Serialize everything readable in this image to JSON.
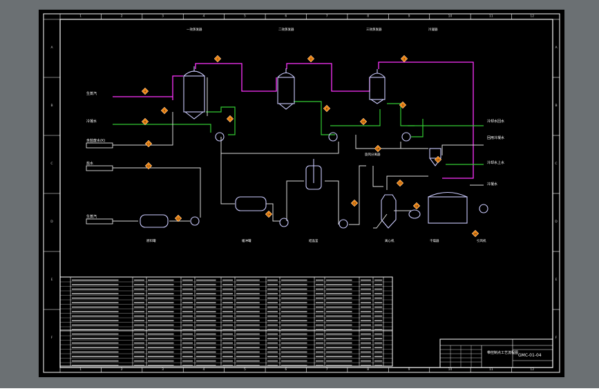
{
  "viewport": {
    "background": "#6b7073",
    "sheet": "#000000",
    "border": "#ffffff"
  },
  "frame": {
    "col_labels": [
      "1",
      "2",
      "3",
      "4",
      "5",
      "6",
      "7",
      "8",
      "9",
      "10",
      "11",
      "12"
    ],
    "row_labels": [
      "A",
      "B",
      "C",
      "D",
      "E",
      "F"
    ]
  },
  "colors": {
    "steam": "#ff33ff",
    "water": "#33cc33",
    "process": "#ffffff",
    "equipment": "#ccccff",
    "tag_fill": "#f28a1a",
    "text": "#ffffff"
  },
  "diagram": {
    "streams_in": [
      "生蒸汽",
      "冷却水",
      "含盐废水(K)",
      "盐水",
      "生蒸汽"
    ],
    "streams_out": [
      "冷凝水",
      "冷却水回水",
      "回用冷凝水",
      "冷却水上水",
      "冷凝水"
    ],
    "equipment": [
      "一效蒸发器",
      "二效蒸发器",
      "三效蒸发器",
      "冷凝器",
      "原料罐",
      "缓冲罐",
      "结晶釜",
      "离心机",
      "干燥器",
      "旋风分离器",
      "引风机"
    ],
    "tags": [
      "1",
      "2",
      "3",
      "4",
      "5",
      "6",
      "7",
      "8",
      "9",
      "10",
      "11",
      "12",
      "13",
      "14",
      "15",
      "16",
      "17",
      "18",
      "19",
      "20"
    ]
  },
  "title_block": {
    "drawing_title": "带控制点工艺流程图",
    "drawing_no": "GMC-01-04"
  }
}
